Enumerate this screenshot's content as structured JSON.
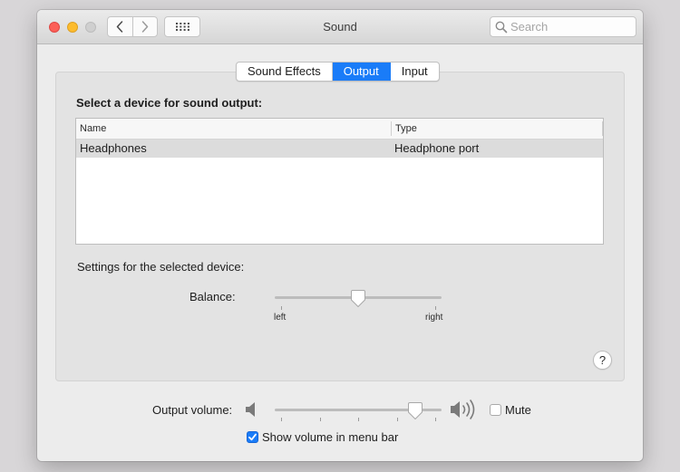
{
  "window": {
    "title": "Sound"
  },
  "search": {
    "placeholder": "Search",
    "value": ""
  },
  "tabs": [
    {
      "label": "Sound Effects",
      "selected": false
    },
    {
      "label": "Output",
      "selected": true
    },
    {
      "label": "Input",
      "selected": false
    }
  ],
  "output": {
    "heading": "Select a device for sound output:",
    "columns": [
      "Name",
      "Type"
    ],
    "rows": [
      {
        "name": "Headphones",
        "type": "Headphone port",
        "selected": true
      }
    ],
    "settings_label": "Settings for the selected device:",
    "balance": {
      "label": "Balance:",
      "left_label": "left",
      "right_label": "right",
      "value": 0.5
    }
  },
  "volume": {
    "label": "Output volume:",
    "value": 0.84,
    "mute_label": "Mute",
    "muted": false,
    "show_in_menu_bar_label": "Show volume in menu bar",
    "show_in_menu_bar": true
  },
  "colors": {
    "accent": "#1a7cf8",
    "close": "#fc5f57",
    "minimize": "#fdbc2e",
    "zoom_disabled": "#cfcfcf"
  },
  "icons": {
    "back": "chevron-left-icon",
    "forward": "chevron-right-icon",
    "show_all": "grid-icon",
    "search": "magnifier-icon",
    "help": "question-mark-icon",
    "volume_low": "speaker-low-icon",
    "volume_high": "speaker-high-icon"
  }
}
